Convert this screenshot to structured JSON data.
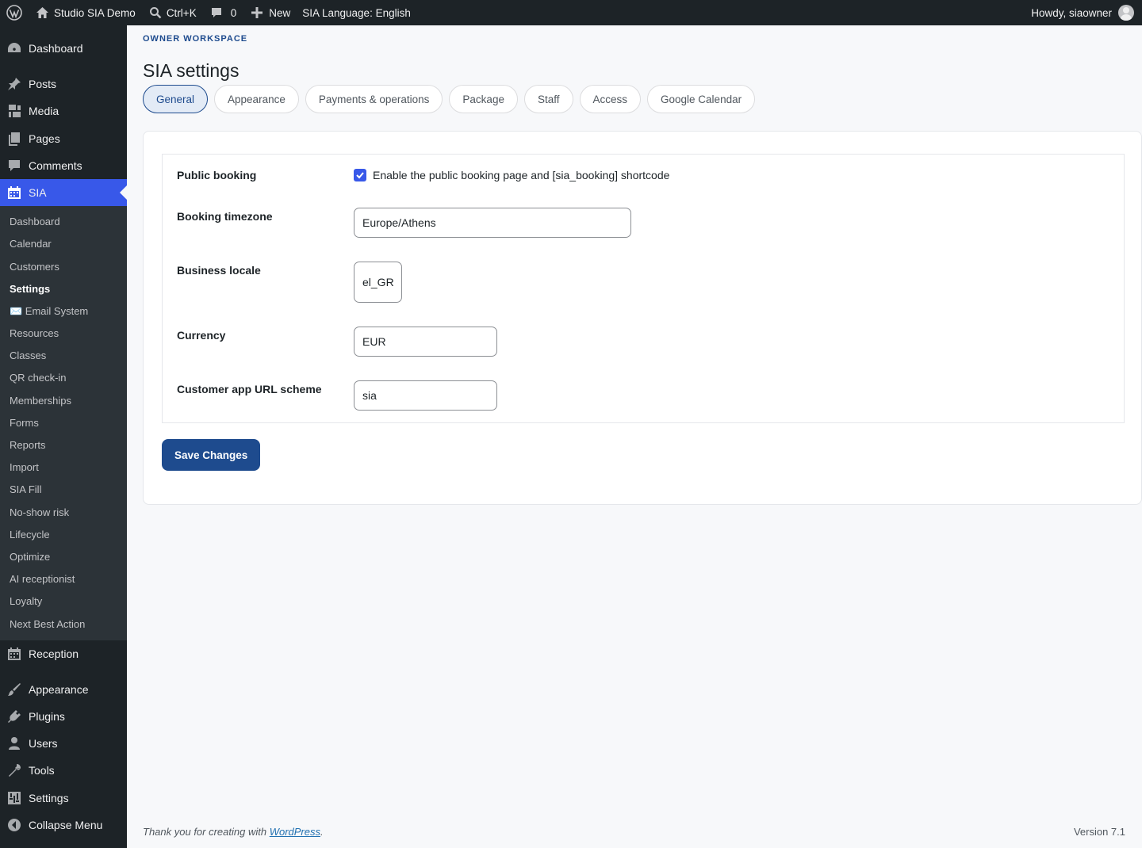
{
  "adminbar": {
    "site_name": "Studio SIA Demo",
    "shortcut": "Ctrl+K",
    "comments_count": "0",
    "new_label": "New",
    "language": "SIA Language: English",
    "howdy": "Howdy, siaowner"
  },
  "sidebar": {
    "top_items": [
      {
        "label": "Dashboard",
        "icon": "gauge-icon"
      },
      {
        "label": "Posts",
        "icon": "pin-icon"
      },
      {
        "label": "Media",
        "icon": "media-icon"
      },
      {
        "label": "Pages",
        "icon": "pages-icon"
      },
      {
        "label": "Comments",
        "icon": "comment-icon"
      },
      {
        "label": "SIA",
        "icon": "calendar-icon"
      }
    ],
    "submenu": [
      "Dashboard",
      "Calendar",
      "Customers",
      "Settings",
      "✉️ Email System",
      "Resources",
      "Classes",
      "QR check-in",
      "Memberships",
      "Forms",
      "Reports",
      "Import",
      "SIA Fill",
      "No-show risk",
      "Lifecycle",
      "Optimize",
      "AI receptionist",
      "Loyalty",
      "Next Best Action"
    ],
    "bottom_items": [
      {
        "label": "Reception",
        "icon": "calendar-icon"
      },
      {
        "label": "Appearance",
        "icon": "brush-icon"
      },
      {
        "label": "Plugins",
        "icon": "plug-icon"
      },
      {
        "label": "Users",
        "icon": "user-icon"
      },
      {
        "label": "Tools",
        "icon": "wrench-icon"
      },
      {
        "label": "Settings",
        "icon": "sliders-icon"
      },
      {
        "label": "Collapse Menu",
        "icon": "collapse-icon"
      }
    ]
  },
  "page": {
    "eyebrow": "Owner workspace",
    "title": "SIA settings",
    "tabs": [
      "General",
      "Appearance",
      "Payments & operations",
      "Package",
      "Staff",
      "Access",
      "Google Calendar"
    ],
    "active_tab": "General"
  },
  "form": {
    "public_booking_label": "Public booking",
    "public_booking_checkbox": "Enable the public booking page and [sia_booking] shortcode",
    "public_booking_checked": true,
    "timezone_label": "Booking timezone",
    "timezone_value": "Europe/Athens",
    "locale_label": "Business locale",
    "locale_value": "el_GR",
    "currency_label": "Currency",
    "currency_value": "EUR",
    "url_scheme_label": "Customer app URL scheme",
    "url_scheme_value": "sia",
    "save_label": "Save Changes"
  },
  "footer": {
    "thanks_prefix": "Thank you for creating with ",
    "thanks_link": "WordPress",
    "thanks_suffix": ".",
    "version": "Version 7.1"
  },
  "colors": {
    "accent": "#3858e9",
    "primary_button": "#1e4b8e",
    "admin_dark": "#1d2327"
  }
}
